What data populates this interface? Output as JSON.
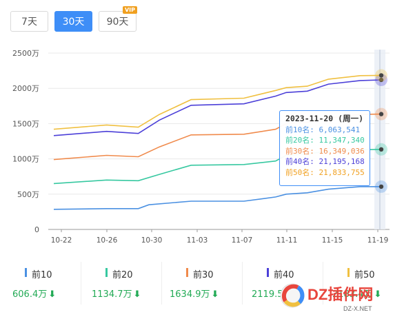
{
  "tabs": [
    {
      "label": "7天",
      "active": false
    },
    {
      "label": "30天",
      "active": true
    },
    {
      "label": "90天",
      "active": false,
      "badge": "VIP"
    }
  ],
  "chart_data": {
    "type": "line",
    "y_tick_labels": [
      "0",
      "500万",
      "1000万",
      "1500万",
      "2000万",
      "2500万"
    ],
    "ylim": [
      0,
      25000000
    ],
    "x_tick_labels": [
      "10-22",
      "10-26",
      "10-30",
      "11-03",
      "11-07",
      "11-11",
      "11-15",
      "11-19"
    ],
    "series": [
      {
        "name": "前10",
        "color": "#4a90e2",
        "points": [
          [
            0,
            2.85
          ],
          [
            5,
            2.95
          ],
          [
            8,
            2.95
          ],
          [
            9,
            3.5
          ],
          [
            13,
            4.0
          ],
          [
            18,
            4.0
          ],
          [
            21,
            4.6
          ],
          [
            22,
            5.0
          ],
          [
            24,
            5.2
          ],
          [
            26,
            5.7
          ],
          [
            29,
            6.06
          ],
          [
            31,
            6.064
          ]
        ]
      },
      {
        "name": "前20",
        "color": "#36c8a0",
        "points": [
          [
            0,
            6.5
          ],
          [
            5,
            7.0
          ],
          [
            8,
            6.9
          ],
          [
            10,
            7.8
          ],
          [
            13,
            9.1
          ],
          [
            18,
            9.2
          ],
          [
            21,
            9.7
          ],
          [
            22,
            10.5
          ],
          [
            24,
            10.7
          ],
          [
            26,
            11.1
          ],
          [
            29,
            11.3
          ],
          [
            31,
            11.347
          ]
        ]
      },
      {
        "name": "前30",
        "color": "#f08a4b",
        "points": [
          [
            0,
            9.9
          ],
          [
            5,
            10.5
          ],
          [
            8,
            10.3
          ],
          [
            10,
            11.7
          ],
          [
            13,
            13.4
          ],
          [
            18,
            13.5
          ],
          [
            21,
            14.2
          ],
          [
            22,
            15.0
          ],
          [
            24,
            15.2
          ],
          [
            26,
            15.8
          ],
          [
            29,
            16.3
          ],
          [
            31,
            16.349
          ]
        ]
      },
      {
        "name": "前40",
        "color": "#4b3fd8",
        "points": [
          [
            0,
            13.3
          ],
          [
            5,
            13.9
          ],
          [
            8,
            13.6
          ],
          [
            10,
            15.5
          ],
          [
            13,
            17.6
          ],
          [
            18,
            17.8
          ],
          [
            21,
            18.9
          ],
          [
            22,
            19.4
          ],
          [
            24,
            19.6
          ],
          [
            26,
            20.6
          ],
          [
            29,
            21.1
          ],
          [
            31,
            21.195
          ]
        ]
      },
      {
        "name": "前50",
        "color": "#f0c040",
        "points": [
          [
            0,
            14.2
          ],
          [
            5,
            14.8
          ],
          [
            8,
            14.5
          ],
          [
            10,
            16.3
          ],
          [
            13,
            18.4
          ],
          [
            18,
            18.6
          ],
          [
            21,
            19.7
          ],
          [
            22,
            20.1
          ],
          [
            24,
            20.3
          ],
          [
            26,
            21.3
          ],
          [
            29,
            21.8
          ],
          [
            31,
            21.834
          ]
        ]
      }
    ]
  },
  "tooltip": {
    "title": "2023-11-20 (周一)",
    "rows": [
      {
        "label": "前10名: 6,063,541",
        "color": "#4a90e2"
      },
      {
        "label": "前20名: 11,347,340",
        "color": "#36c8a0"
      },
      {
        "label": "前30名: 16,349,036",
        "color": "#f08a4b"
      },
      {
        "label": "前40名: 21,195,168",
        "color": "#4b3fd8"
      },
      {
        "label": "前50名: 21,833,755",
        "color": "#f0a020"
      }
    ]
  },
  "legend": [
    {
      "name": "前10",
      "value": "606.4万",
      "color": "#4a90e2"
    },
    {
      "name": "前20",
      "value": "1134.7万",
      "color": "#36c8a0"
    },
    {
      "name": "前30",
      "value": "1634.9万",
      "color": "#f08a4b"
    },
    {
      "name": "前40",
      "value": "2119.5万",
      "color": "#4b3fd8"
    },
    {
      "name": "前50",
      "value": "2183.4万",
      "color": "#f0c040"
    }
  ],
  "watermark": {
    "brand": "DZ插件网",
    "domain": "DZ-X.NET"
  }
}
